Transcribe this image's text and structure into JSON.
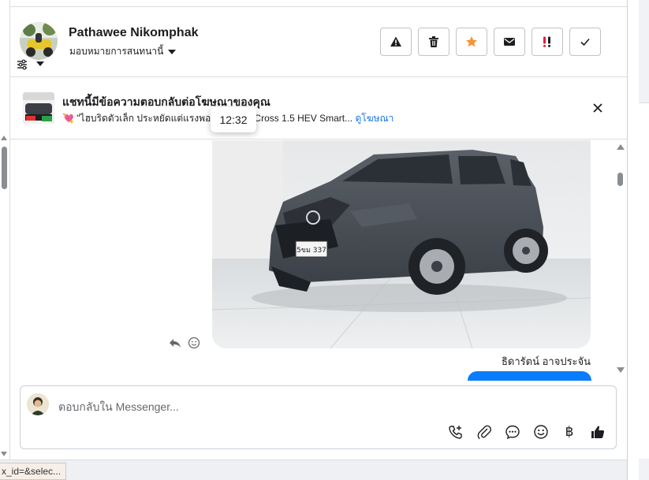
{
  "contact": {
    "name": "Pathawee Nikomphak",
    "assignment": "มอบหมายการสนทนานี้"
  },
  "header_actions": [
    {
      "name": "report-button",
      "icon": "warning-icon"
    },
    {
      "name": "delete-button",
      "icon": "trash-icon"
    },
    {
      "name": "star-button",
      "icon": "star-icon"
    },
    {
      "name": "mark-unread-button",
      "icon": "envelope-icon"
    },
    {
      "name": "priority-button",
      "icon": "priority-icon"
    },
    {
      "name": "done-button",
      "icon": "check-icon"
    }
  ],
  "ad": {
    "title": "แชทนี้มีข้อความตอบกลับต่อโฆษณาของคุณ",
    "subtitle": "\"ไฮบริดตัวเล็ก ประหยัดแต่แรงพอดี",
    "subtitle_tail": "Cross 1.5 HEV Smart...",
    "link": "ดูโฆษณา"
  },
  "tooltip": {
    "time": "12:32"
  },
  "conversation": {
    "sender": "ธิดารัตน์ อาจประจัน",
    "image": "grey-suv-photo",
    "plate": "5ขม 337"
  },
  "composer": {
    "placeholder": "ตอบกลับใน Messenger...",
    "baht_symbol": "฿"
  },
  "status_bar": {
    "url": "x_id=&selec..."
  },
  "colors": {
    "accent": "#1b74e4",
    "bubble": "#0a7cff",
    "star": "#f7923a",
    "priority": "#e41e3f"
  }
}
